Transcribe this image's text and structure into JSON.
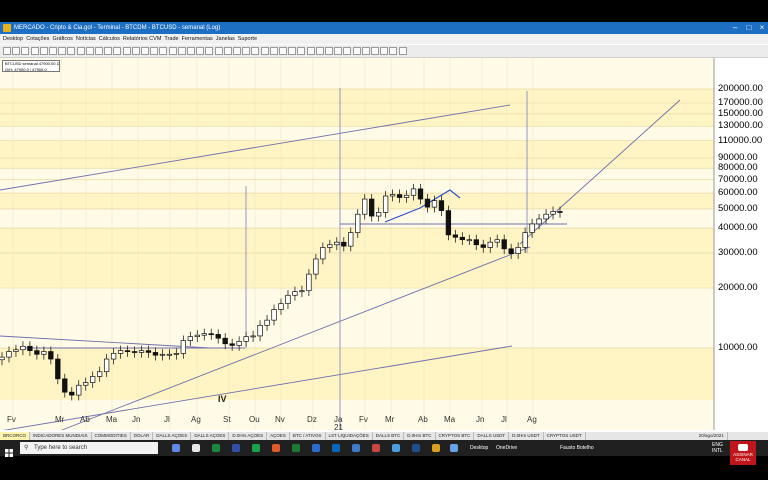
{
  "window": {
    "title": "MERCADO - Cripto & Cia.gol - Terminal - BTCDM - BTCUSD - semanal (Log)"
  },
  "menu": [
    "Desktop",
    "Cotações",
    "Gráficos",
    "Notícias",
    "Cálculos",
    "Relatórios CVM",
    "Trade",
    "Ferramentas",
    "Janelas",
    "Suporte"
  ],
  "chart": {
    "symbol_info": [
      "BTCUSD semanal 47900.00 D",
      "O/H: 47900.0 / 47900.0"
    ],
    "price_labels": [
      "200000.00",
      "170000.00",
      "150000.00",
      "130000.00",
      "110000.00",
      "90000.00",
      "80000.00",
      "70000.00",
      "60000.00",
      "50000.00",
      "40000.00",
      "30000.00",
      "20000.00",
      "10000.00"
    ],
    "months": [
      "Fv",
      "Mr",
      "Ab",
      "Ma",
      "Jn",
      "Jl",
      "Ag",
      "St",
      "Ou",
      "Nv",
      "Dz",
      "Ja",
      "Fv",
      "Mr",
      "Ab",
      "Ma",
      "Jn",
      "Jl",
      "Ag"
    ],
    "year_marker": "21",
    "wave_label": "IV",
    "scale": "log"
  },
  "bottom_tabs": [
    "BRCORCO",
    "INDICADORES MUNDIAIS",
    "COMMODITIES",
    "DOLAR",
    "DALLS AÇOES",
    "DALLS AÇOES",
    "D.0Hrs AÇOES",
    "AÇOES",
    "BTC / ATIVOS",
    "LST LIQUIDAÇÕES",
    "DALLS BTC",
    "D.0Hrs BTC",
    "CRYPTOS BTC",
    "DALLS USDT",
    "D.0Hrs USDT",
    "CRYPTOS USDT"
  ],
  "status_date": "20/ago/2021",
  "taskbar": {
    "search_placeholder": "Type here to search",
    "apps": [
      "Desktop",
      "OneDrive",
      "Fausto Botelho"
    ],
    "tray_lang": "ENG",
    "tray_region": "INTL",
    "badge": "ASSINAR CANAL"
  },
  "colors": {
    "titlebar": "#1d6fc4",
    "band": "#fff4c4",
    "taskbar": "#202020"
  }
}
